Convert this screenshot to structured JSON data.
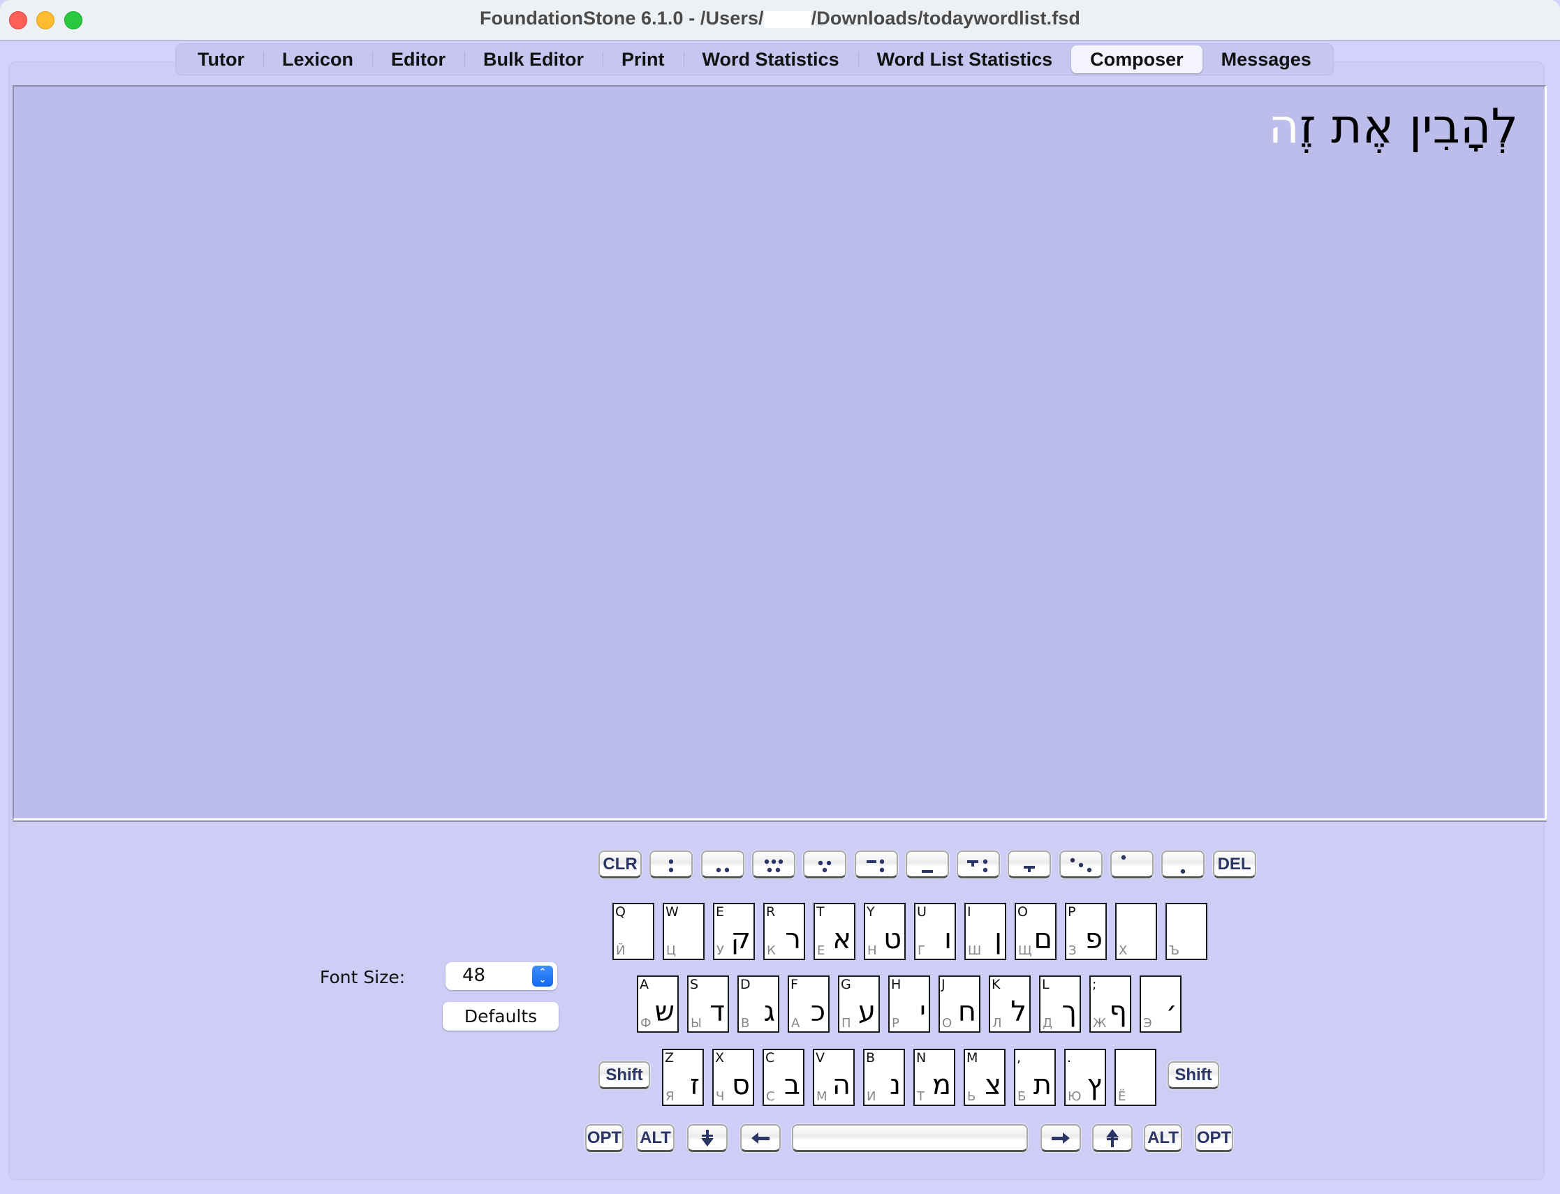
{
  "window": {
    "title_prefix": "FoundationStone 6.1.0 - /Users/",
    "title_suffix": "/Downloads/todaywordlist.fsd"
  },
  "tabs": [
    {
      "label": "Tutor",
      "active": false
    },
    {
      "label": "Lexicon",
      "active": false
    },
    {
      "label": "Editor",
      "active": false
    },
    {
      "label": "Bulk Editor",
      "active": false
    },
    {
      "label": "Print",
      "active": false
    },
    {
      "label": "Word Statistics",
      "active": false
    },
    {
      "label": "Word List Statistics",
      "active": false
    },
    {
      "label": "Composer",
      "active": true
    },
    {
      "label": "Messages",
      "active": false
    }
  ],
  "composer": {
    "text_main": "לְהָבִין אֶת זֶ",
    "text_cursor_char": "ה"
  },
  "font_size": {
    "label": "Font Size:",
    "value": "48",
    "defaults_label": "Defaults"
  },
  "vowel_row": [
    {
      "name": "clr-key",
      "label": "CLR",
      "icon": "text"
    },
    {
      "name": "sheva-key",
      "label": "",
      "icon": "sheva"
    },
    {
      "name": "tsere-key",
      "label": "",
      "icon": "tsere"
    },
    {
      "name": "hataf-segol-key",
      "label": "",
      "icon": "hataf-segol"
    },
    {
      "name": "segol-key",
      "label": "",
      "icon": "segol"
    },
    {
      "name": "hataf-patah-key",
      "label": "",
      "icon": "hataf-patah"
    },
    {
      "name": "patah-key",
      "label": "",
      "icon": "patah"
    },
    {
      "name": "hataf-qamats-key",
      "label": "",
      "icon": "hataf-qamats"
    },
    {
      "name": "qamats-key",
      "label": "",
      "icon": "qamats"
    },
    {
      "name": "qubuts-key",
      "label": "",
      "icon": "qubuts"
    },
    {
      "name": "holam-key",
      "label": "",
      "icon": "holam"
    },
    {
      "name": "hiriq-key",
      "label": "",
      "icon": "hiriq"
    },
    {
      "name": "del-key",
      "label": "DEL",
      "icon": "text"
    }
  ],
  "keyboard_rows": [
    [
      {
        "lat": "Q",
        "cyr": "Й",
        "heb": ""
      },
      {
        "lat": "W",
        "cyr": "Ц",
        "heb": ""
      },
      {
        "lat": "E",
        "cyr": "У",
        "heb": "ק"
      },
      {
        "lat": "R",
        "cyr": "К",
        "heb": "ר"
      },
      {
        "lat": "T",
        "cyr": "Е",
        "heb": "א"
      },
      {
        "lat": "Y",
        "cyr": "Н",
        "heb": "ט"
      },
      {
        "lat": "U",
        "cyr": "Г",
        "heb": "ו"
      },
      {
        "lat": "I",
        "cyr": "Ш",
        "heb": "ן"
      },
      {
        "lat": "O",
        "cyr": "Щ",
        "heb": "ם"
      },
      {
        "lat": "P",
        "cyr": "З",
        "heb": "פ"
      },
      {
        "lat": "",
        "cyr": "Х",
        "heb": ""
      },
      {
        "lat": "",
        "cyr": "Ъ",
        "heb": ""
      }
    ],
    [
      {
        "lat": "A",
        "cyr": "Ф",
        "heb": "ש"
      },
      {
        "lat": "S",
        "cyr": "Ы",
        "heb": "ד"
      },
      {
        "lat": "D",
        "cyr": "В",
        "heb": "ג"
      },
      {
        "lat": "F",
        "cyr": "А",
        "heb": "כ"
      },
      {
        "lat": "G",
        "cyr": "П",
        "heb": "ע"
      },
      {
        "lat": "H",
        "cyr": "Р",
        "heb": "י"
      },
      {
        "lat": "J",
        "cyr": "О",
        "heb": "ח"
      },
      {
        "lat": "K",
        "cyr": "Л",
        "heb": "ל"
      },
      {
        "lat": "L",
        "cyr": "Д",
        "heb": "ך"
      },
      {
        "lat": ";",
        "cyr": "Ж",
        "heb": "ף"
      },
      {
        "lat": "",
        "cyr": "Э",
        "heb": "׳"
      }
    ],
    [
      {
        "lat": "Z",
        "cyr": "Я",
        "heb": "ז"
      },
      {
        "lat": "X",
        "cyr": "Ч",
        "heb": "ס"
      },
      {
        "lat": "C",
        "cyr": "С",
        "heb": "ב"
      },
      {
        "lat": "V",
        "cyr": "М",
        "heb": "ה"
      },
      {
        "lat": "B",
        "cyr": "И",
        "heb": "נ"
      },
      {
        "lat": "N",
        "cyr": "Т",
        "heb": "מ"
      },
      {
        "lat": "M",
        "cyr": "Ь",
        "heb": "צ"
      },
      {
        "lat": ",",
        "cyr": "Б",
        "heb": "ת"
      },
      {
        "lat": ".",
        "cyr": "Ю",
        "heb": "ץ"
      },
      {
        "lat": "",
        "cyr": "Ё",
        "heb": ""
      }
    ]
  ],
  "shift_label": "Shift",
  "bottom_row": {
    "opt_left": "OPT",
    "alt_left": "ALT",
    "alt_right": "ALT",
    "opt_right": "OPT"
  }
}
